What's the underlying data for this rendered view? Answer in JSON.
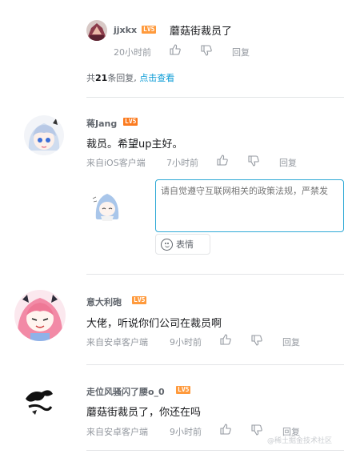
{
  "colors": {
    "level_badge": "#ff9a3c",
    "link": "#0a9bd6",
    "editor_border": "#2fa9d6",
    "meta_text": "#9499a0"
  },
  "sub_reply": {
    "username": "jjxkx",
    "level": "LV5",
    "content": "蘑菇街裁员了",
    "time": "20小时前",
    "reply_label": "回复"
  },
  "reply_summary": {
    "prefix": "共",
    "count": "21",
    "suffix": "条回复,",
    "view_link": "点击查看"
  },
  "comments": [
    {
      "username": "蒋Jang",
      "level": "LV5",
      "content": "裁员。希望up主好。",
      "source": "来自iOS客户端",
      "time": "7小时前",
      "reply_label": "回复"
    },
    {
      "username": "意大利砲",
      "level": "LV5",
      "content": "大佬，听说你们公司在裁员啊",
      "source": "来自安卓客户端",
      "time": "9小时前",
      "reply_label": "回复"
    },
    {
      "username": "走位风骚闪了腰o_0",
      "level": "LV5",
      "content": "蘑菇街裁员了，你还在吗",
      "source": "来自安卓客户端",
      "time": "9小时前",
      "reply_label": "回复"
    }
  ],
  "reply_editor": {
    "placeholder": "请自觉遵守互联网相关的政策法规，严禁发",
    "emoji_label": "表情",
    "icon": "smile-icon"
  },
  "watermark": "@稀土掘金技术社区"
}
